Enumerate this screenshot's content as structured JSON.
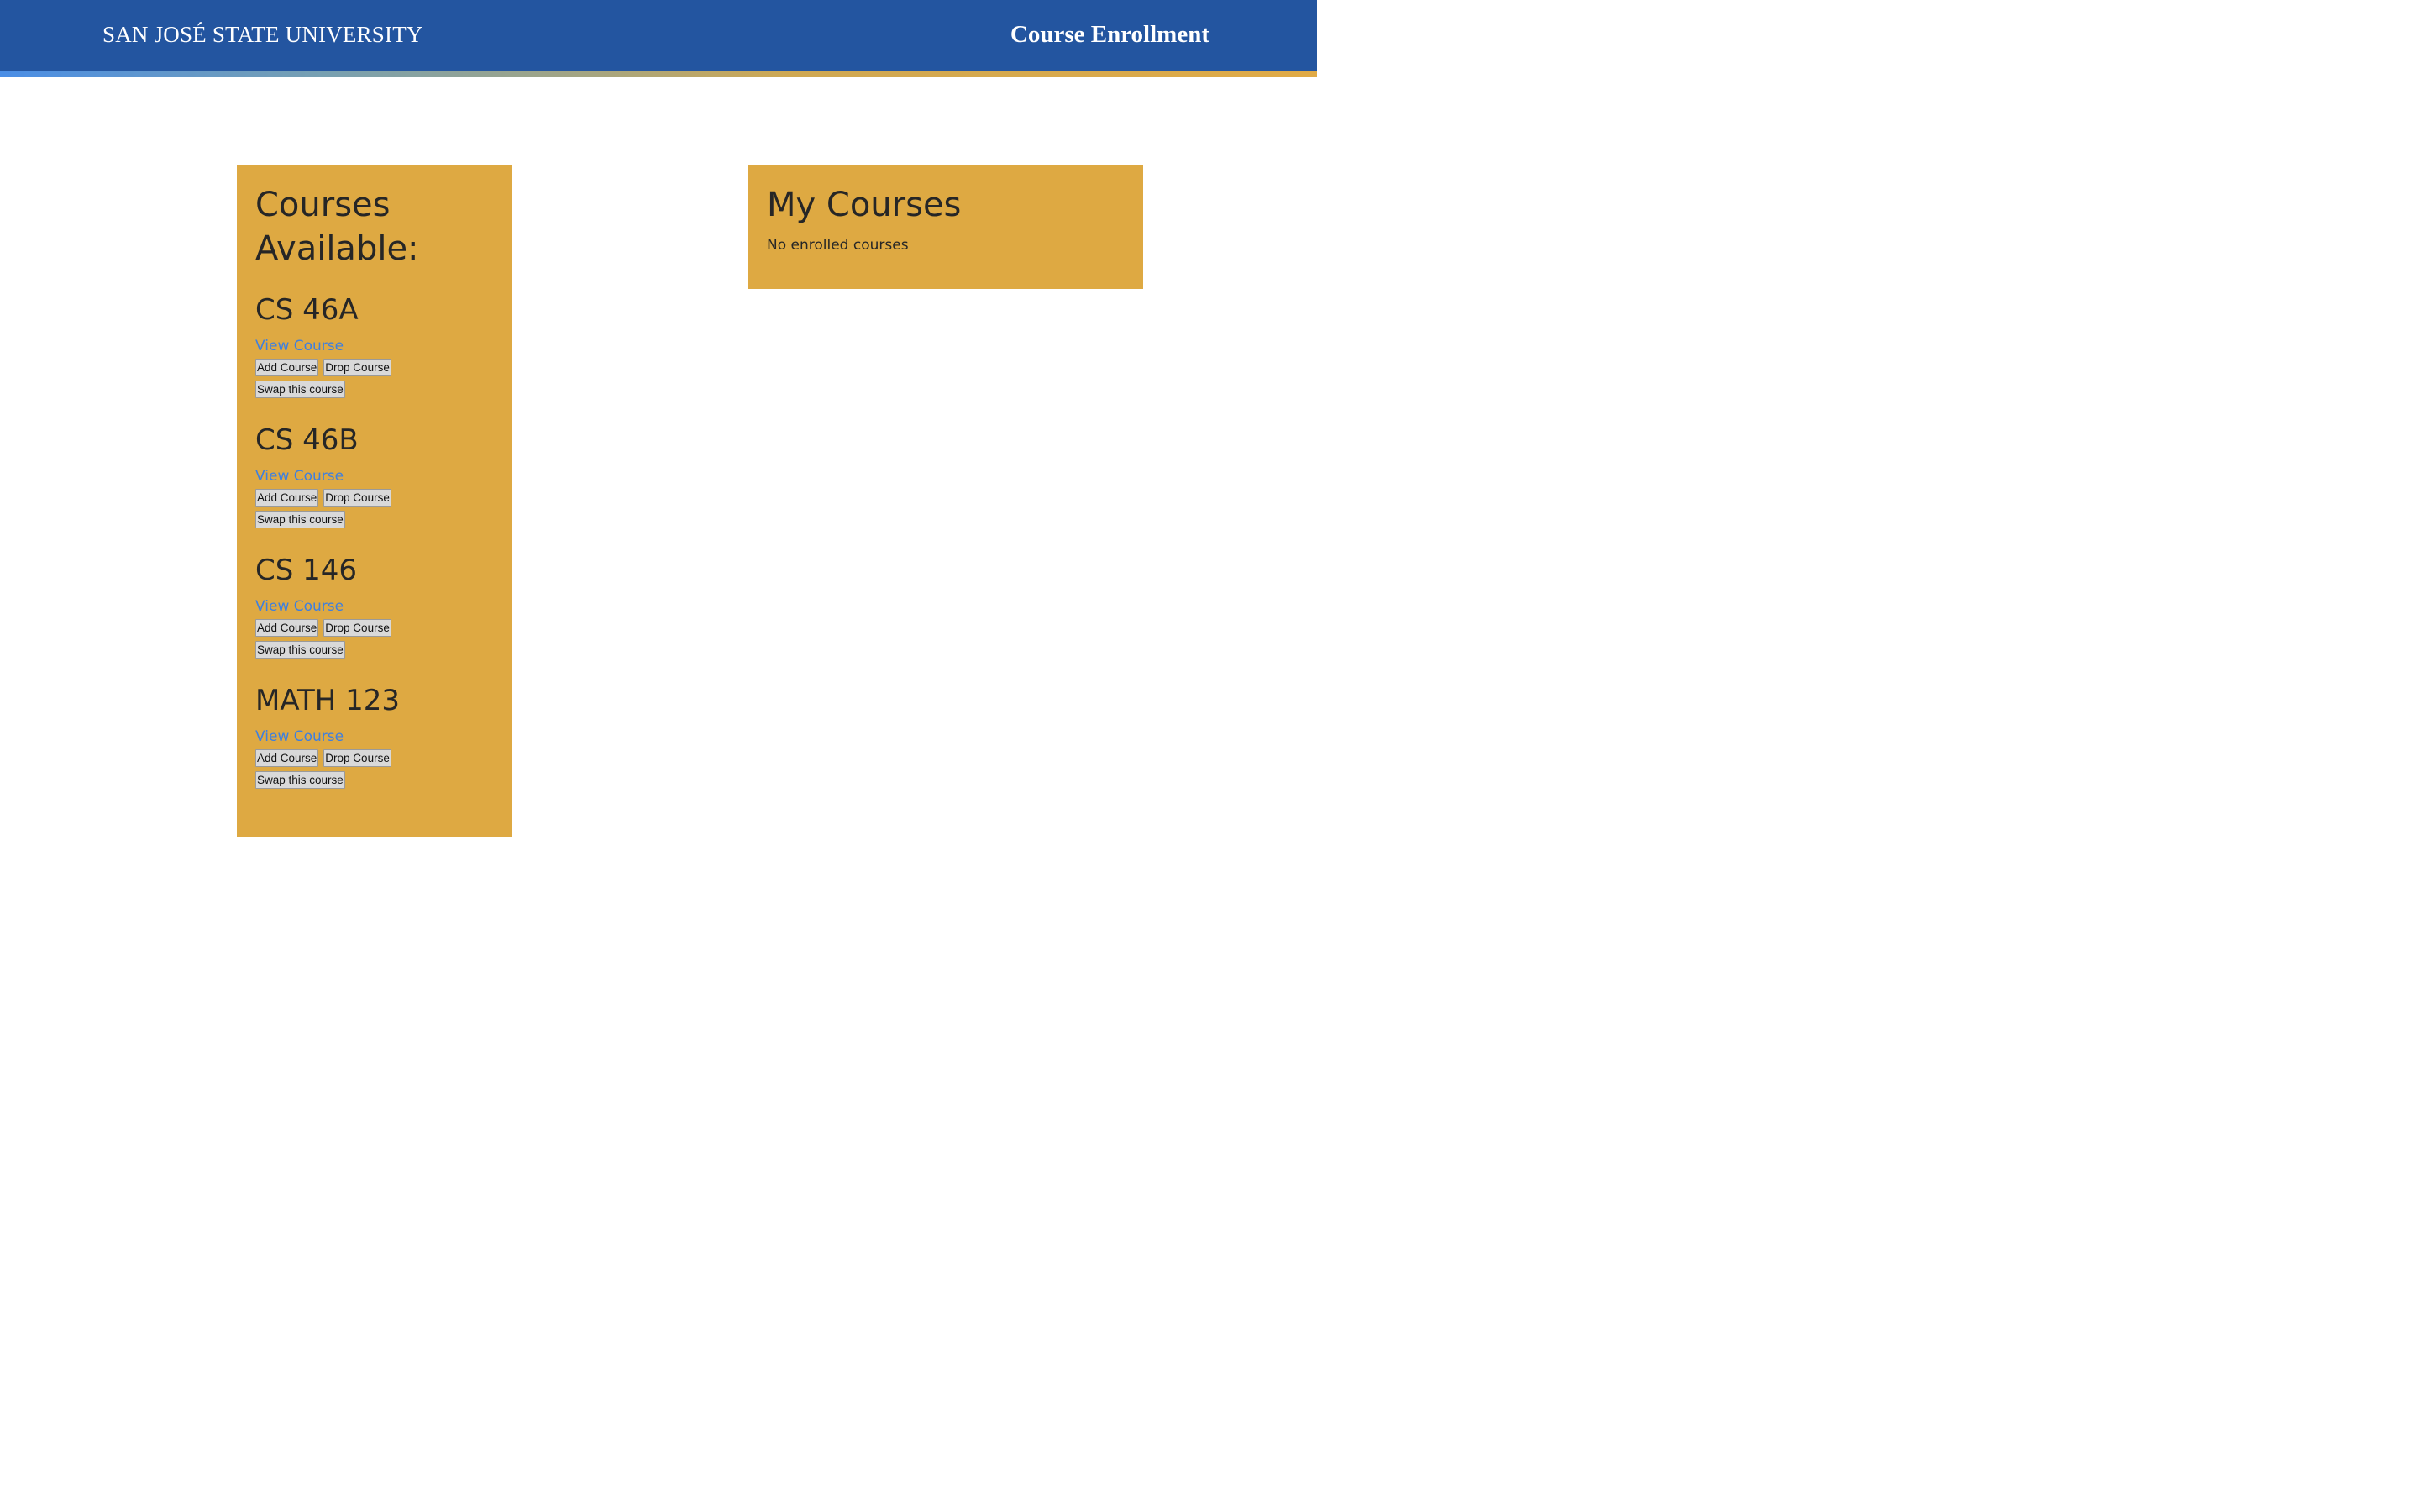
{
  "header": {
    "brand": "SAN JOSÉ STATE UNIVERSITY",
    "title": "Course Enrollment"
  },
  "available": {
    "heading_line1": "Courses",
    "heading_line2": "Available:",
    "courses": [
      {
        "code": "CS 46A",
        "view_label": "View Course",
        "add_label": "Add Course",
        "drop_label": "Drop Course",
        "swap_label": "Swap this course"
      },
      {
        "code": "CS 46B",
        "view_label": "View Course",
        "add_label": "Add Course",
        "drop_label": "Drop Course",
        "swap_label": "Swap this course"
      },
      {
        "code": "CS 146",
        "view_label": "View Course",
        "add_label": "Add Course",
        "drop_label": "Drop Course",
        "swap_label": "Swap this course"
      },
      {
        "code": "MATH 123",
        "view_label": "View Course",
        "add_label": "Add Course",
        "drop_label": "Drop Course",
        "swap_label": "Swap this course"
      }
    ]
  },
  "my_courses": {
    "heading": "My Courses",
    "empty_text": "No enrolled courses"
  },
  "colors": {
    "header_bg": "#2355a0",
    "panel_bg": "#dea942",
    "link": "#3d7fe0"
  }
}
